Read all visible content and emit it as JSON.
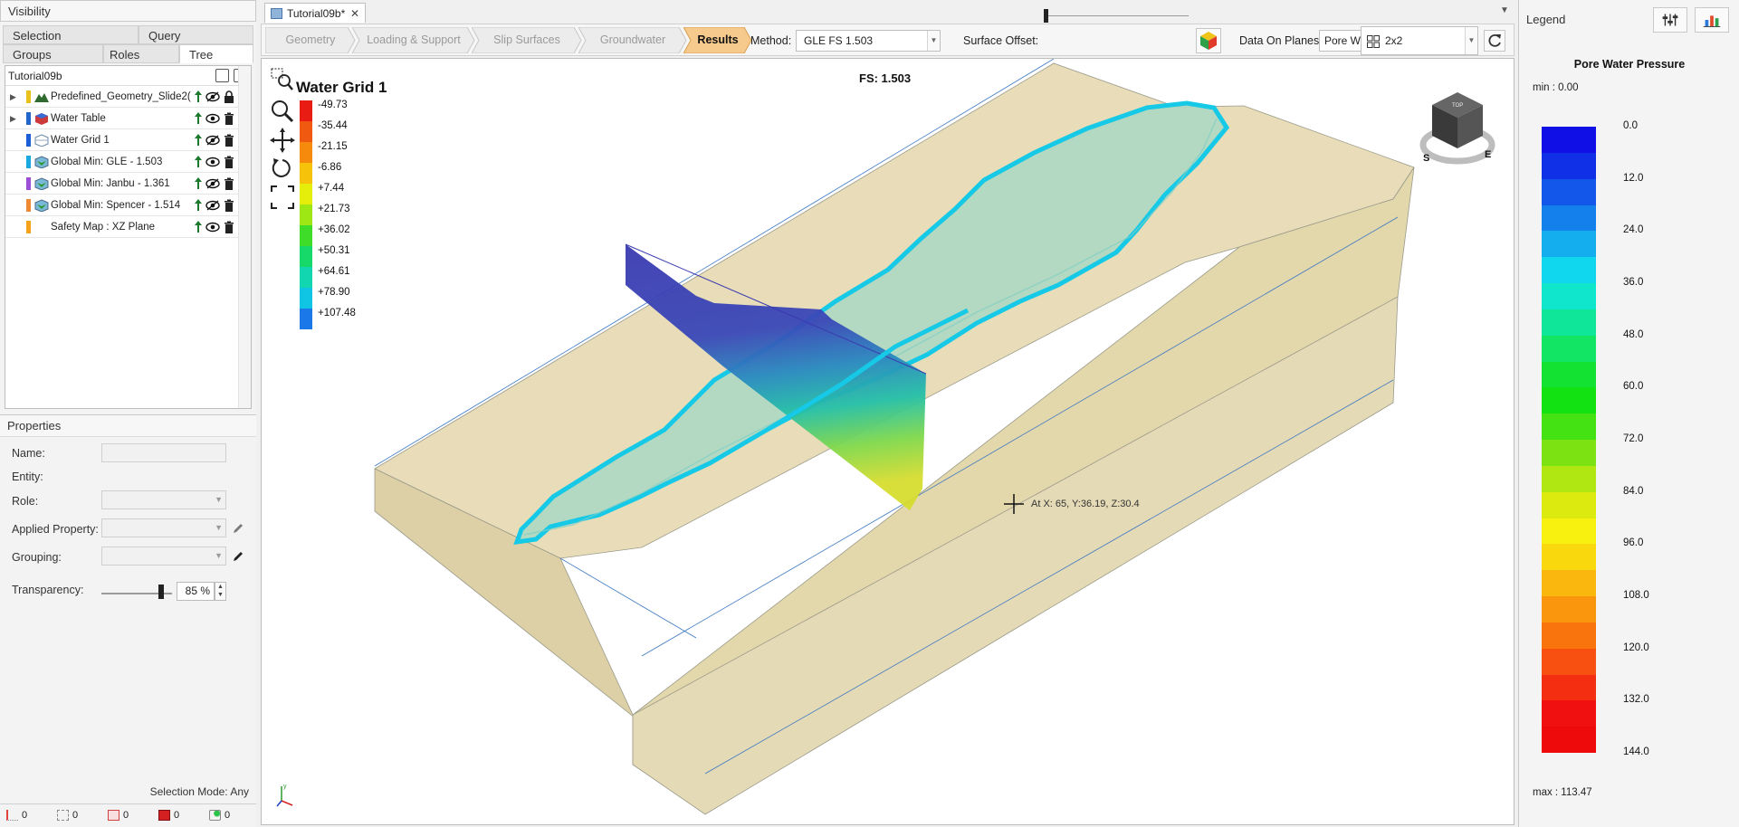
{
  "visibility": {
    "title": "Visibility",
    "tabs": [
      {
        "label": "Selection"
      },
      {
        "label": "Query"
      },
      {
        "label": "Groups"
      },
      {
        "label": "Roles"
      },
      {
        "label": "Tree"
      }
    ],
    "tree_root": "Tutorial09b",
    "items": [
      {
        "label": "Predefined_Geometry_Slide2(",
        "color": "#e8c21a",
        "icon": "terrain-icon",
        "expandable": true,
        "visible": false,
        "locked": true
      },
      {
        "label": "Water Table",
        "color": "#2266cc",
        "icon": "water-table-icon",
        "expandable": true,
        "visible": true
      },
      {
        "label": "Water Grid 1",
        "color": "#1a5fd6",
        "icon": "water-grid-icon",
        "expandable": false,
        "visible": false
      },
      {
        "label": "Global Min: GLE  -  1.503",
        "color": "#1aa8e0",
        "icon": "slip-surface-icon",
        "expandable": false,
        "visible": true
      },
      {
        "label": "Global Min: Janbu  -  1.361",
        "color": "#9b4fd6",
        "icon": "slip-surface-icon",
        "expandable": false,
        "visible": false
      },
      {
        "label": "Global Min: Spencer  -  1.514",
        "color": "#ee8a33",
        "icon": "slip-surface-icon",
        "expandable": false,
        "visible": false
      },
      {
        "label": "Safety Map : XZ Plane",
        "color": "#f5a31a",
        "icon": "none",
        "expandable": false,
        "visible": true
      }
    ]
  },
  "properties": {
    "title": "Properties",
    "fields": [
      {
        "label": "Name:"
      },
      {
        "label": "Entity:"
      },
      {
        "label": "Role:"
      },
      {
        "label": "Applied Property:"
      },
      {
        "label": "Grouping:"
      }
    ],
    "transparency_label": "Transparency:",
    "transparency_value": "85 %",
    "selection_mode": "Selection Mode: Any",
    "counters": [
      "0",
      "0",
      "0",
      "0",
      "0"
    ]
  },
  "document": {
    "tab": "Tutorial09b*"
  },
  "workflow": [
    "Geometry",
    "Loading & Support",
    "Slip Surfaces",
    "Groundwater",
    "Results"
  ],
  "toolbar": {
    "method_label": "Method:",
    "method_value": "GLE FS    1.503",
    "surface_offset_label": "Surface Offset:",
    "data_on_planes_label": "Data On Planes:",
    "data_on_planes_value": "Pore Wa",
    "layout_value": "2x2"
  },
  "viewport": {
    "title": "Water Grid 1",
    "fs": "FS: 1.503",
    "coord": "At X: 65, Y:36.19, Z:30.4",
    "scale": [
      {
        "label": "-49.73",
        "color": "#e81c12"
      },
      {
        "label": "-35.44",
        "color": "#ef5a10"
      },
      {
        "label": "-21.15",
        "color": "#f58a0c"
      },
      {
        "label": "-6.86",
        "color": "#f7c20a"
      },
      {
        "label": "+7.44",
        "color": "#e5ee0a"
      },
      {
        "label": "+21.73",
        "color": "#9ee614"
      },
      {
        "label": "+36.02",
        "color": "#3fdc2a"
      },
      {
        "label": "+50.31",
        "color": "#16d96a"
      },
      {
        "label": "+64.61",
        "color": "#12d6b0"
      },
      {
        "label": "+78.90",
        "color": "#10c4e4"
      },
      {
        "label": "+107.48",
        "color": "#1a78e8"
      }
    ]
  },
  "legend": {
    "title": "Legend",
    "name": "Pore Water Pressure",
    "min": "min :  0.00",
    "max": "max :  113.47",
    "ticks": [
      "0.0",
      "12.0",
      "24.0",
      "36.0",
      "48.0",
      "60.0",
      "72.0",
      "84.0",
      "96.0",
      "108.0",
      "120.0",
      "132.0",
      "144.0"
    ],
    "colors": [
      "#1010e6",
      "#1030e8",
      "#1256ea",
      "#1480ec",
      "#14aeee",
      "#10d6ee",
      "#10e6cc",
      "#10e69a",
      "#12e464",
      "#14e232",
      "#12e212",
      "#44e212",
      "#7ce212",
      "#b0e612",
      "#dcea10",
      "#f8f00e",
      "#fad80e",
      "#fab80e",
      "#fa960e",
      "#fa740e",
      "#f85010",
      "#f42e10",
      "#f01010",
      "#ee0a0a"
    ]
  }
}
